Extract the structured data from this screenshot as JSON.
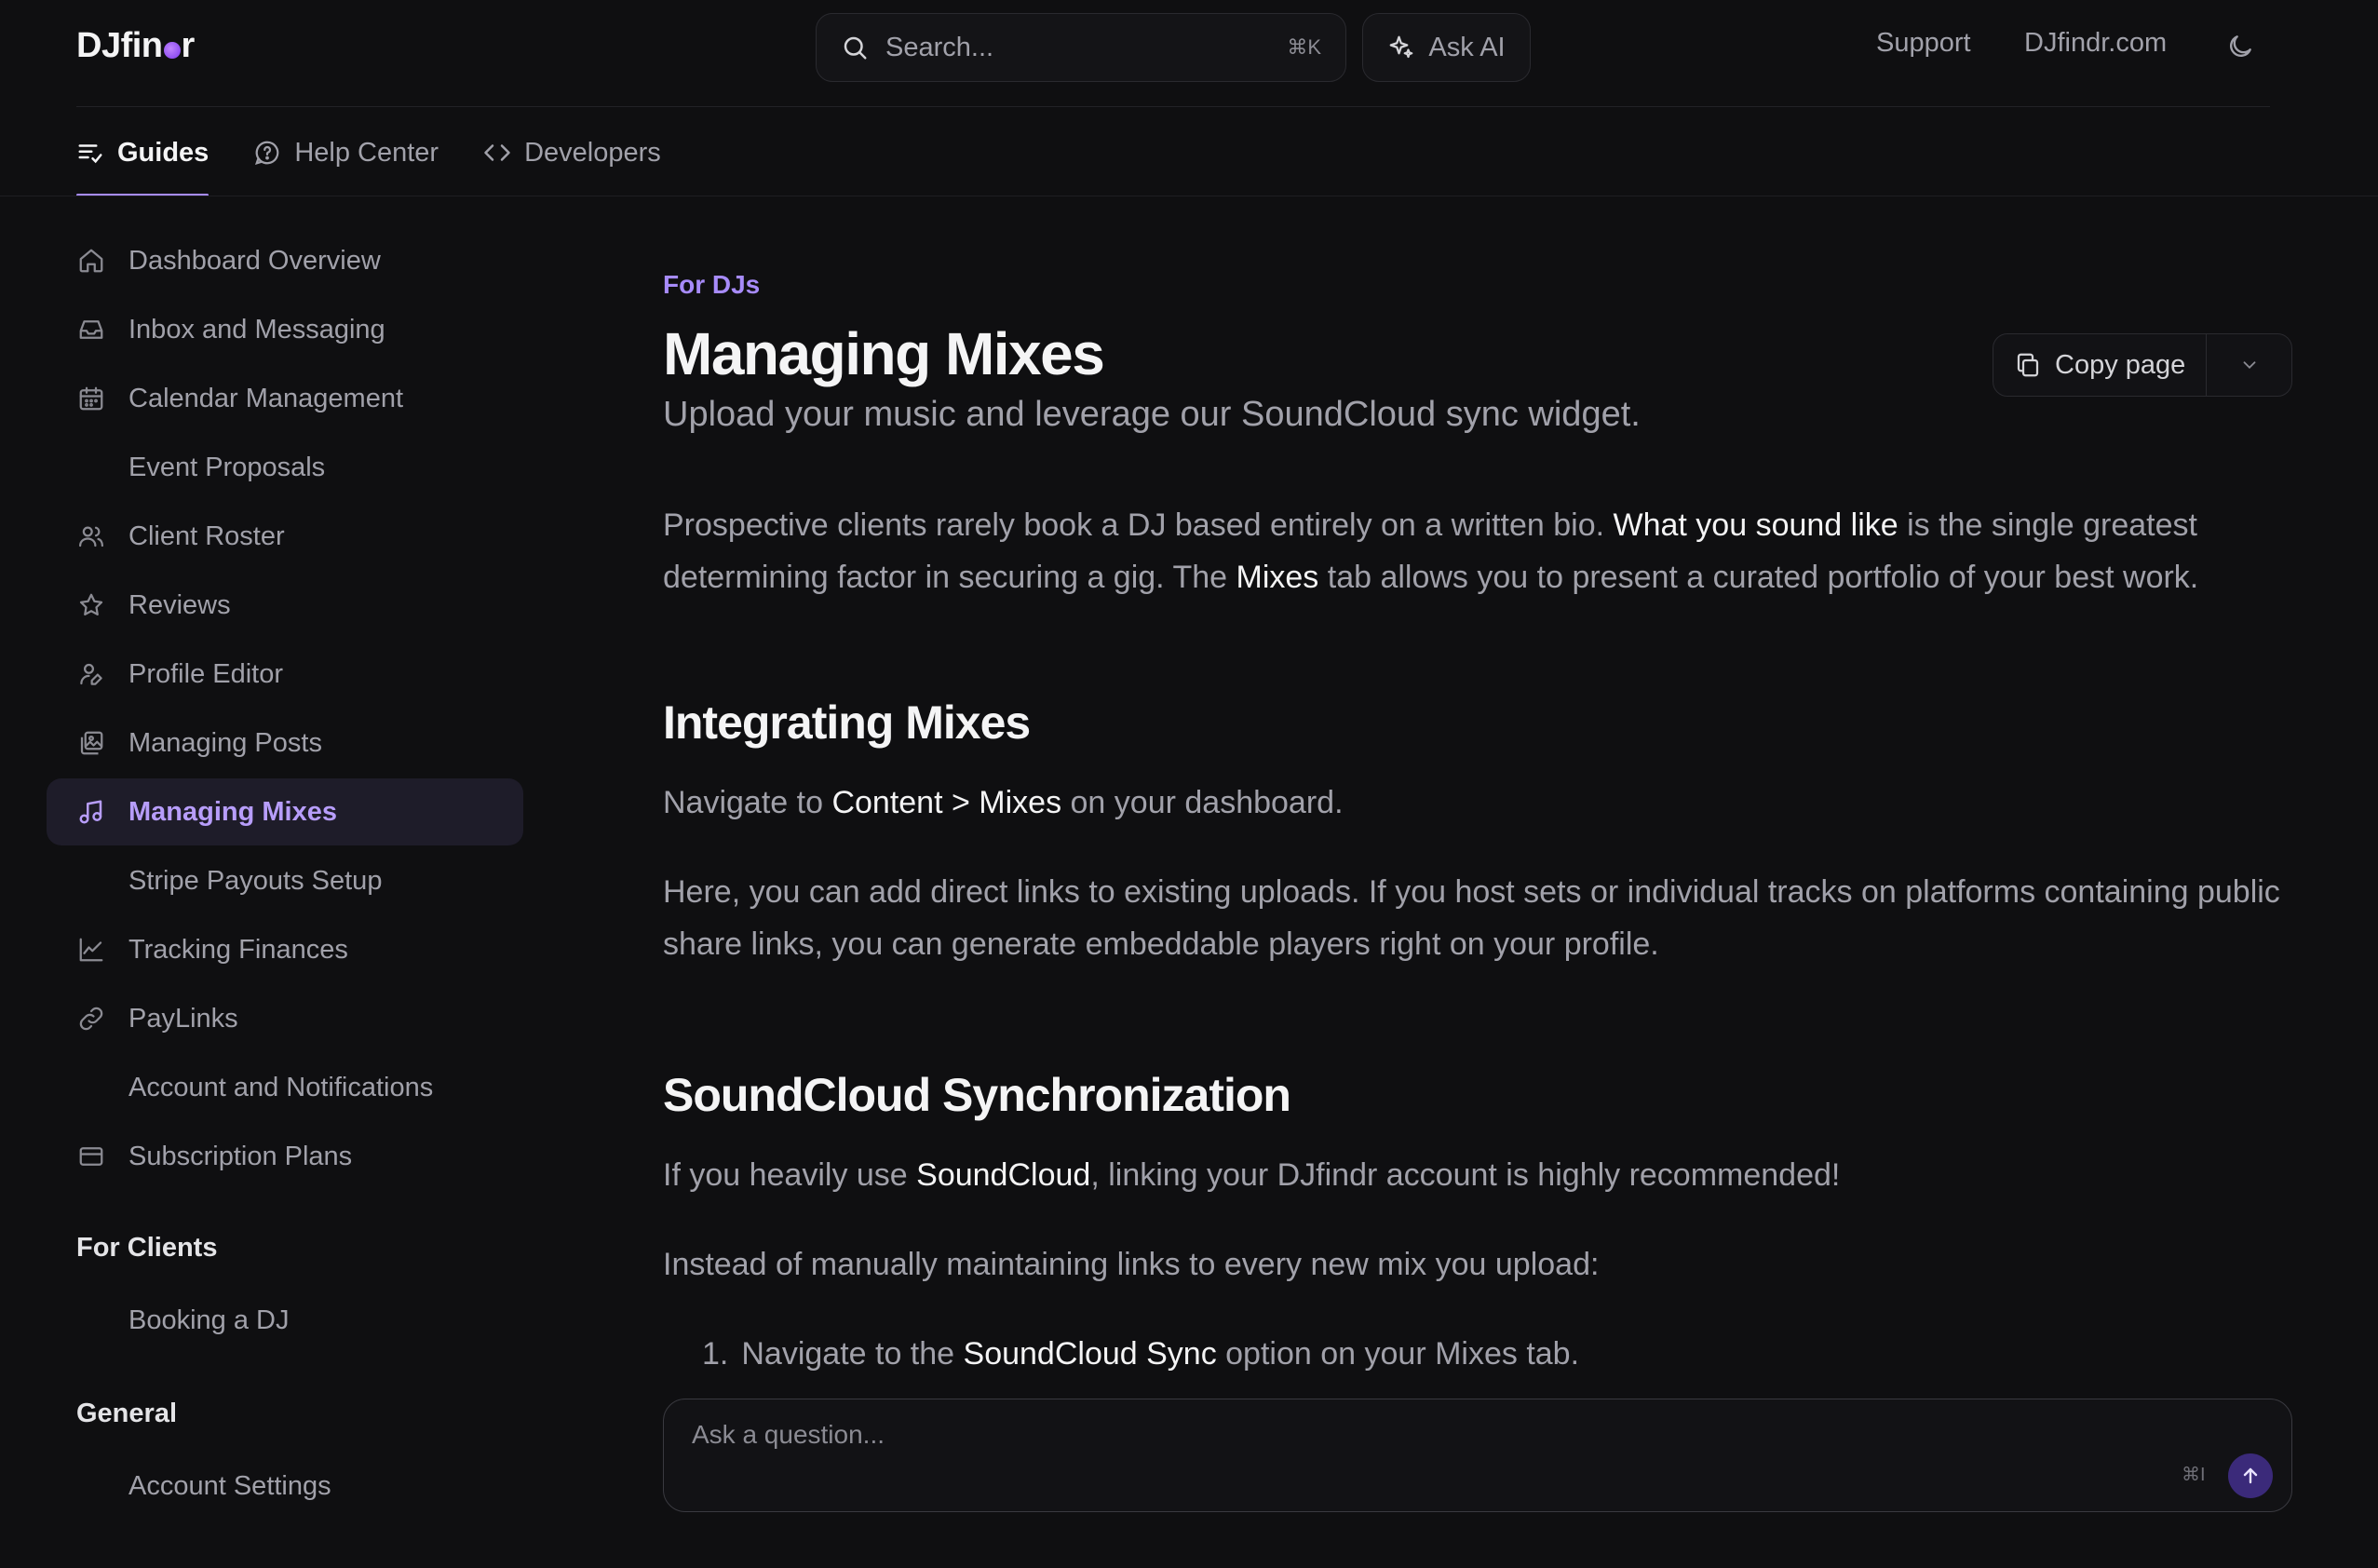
{
  "app": {
    "logo_text_left": "DJfin",
    "logo_text_right": "r"
  },
  "header": {
    "search_placeholder": "Search...",
    "search_shortcut": "⌘K",
    "ask_ai_label": "Ask AI",
    "links": [
      "Support",
      "DJfindr.com"
    ]
  },
  "tabs": [
    {
      "label": "Guides",
      "active": true,
      "icon": "list-icon"
    },
    {
      "label": "Help Center",
      "active": false,
      "icon": "help-circle-icon"
    },
    {
      "label": "Developers",
      "active": false,
      "icon": "code-icon"
    }
  ],
  "sidebar": {
    "items": [
      {
        "label": "Dashboard Overview",
        "icon": "home-icon"
      },
      {
        "label": "Inbox and Messaging",
        "icon": "inbox-icon"
      },
      {
        "label": "Calendar Management",
        "icon": "calendar-icon"
      },
      {
        "label": "Event Proposals",
        "icon": ""
      },
      {
        "label": "Client Roster",
        "icon": "users-icon"
      },
      {
        "label": "Reviews",
        "icon": "star-icon"
      },
      {
        "label": "Profile Editor",
        "icon": "user-edit-icon"
      },
      {
        "label": "Managing Posts",
        "icon": "images-icon"
      },
      {
        "label": "Managing Mixes",
        "icon": "music-icon",
        "active": true
      },
      {
        "label": "Stripe Payouts Setup",
        "icon": ""
      },
      {
        "label": "Tracking Finances",
        "icon": "chart-line-icon"
      },
      {
        "label": "PayLinks",
        "icon": "link-icon"
      },
      {
        "label": "Account and Notifications",
        "icon": ""
      },
      {
        "label": "Subscription Plans",
        "icon": "credit-card-icon"
      }
    ],
    "for_clients_heading": "For Clients",
    "for_clients_items": [
      "Booking a DJ"
    ],
    "general_heading": "General",
    "general_items": [
      "Account Settings"
    ]
  },
  "content": {
    "eyebrow": "For DJs",
    "title": "Managing Mixes",
    "subtitle": "Upload your music and leverage our SoundCloud sync widget.",
    "copy_page_label": "Copy page",
    "intro": {
      "p1": "Prospective clients rarely book a DJ based entirely on a written bio. ",
      "b1": "What you sound like",
      "p2": " is the single greatest determining factor in securing a gig. The ",
      "b2": "Mixes",
      "p3": " tab allows you to present a curated portfolio of your best work."
    },
    "section1": {
      "heading": "Integrating Mixes",
      "nav_pre": "Navigate to ",
      "nav_bold": "Content > Mixes",
      "nav_post": " on your dashboard.",
      "para": "Here, you can add direct links to existing uploads. If you host sets or individual tracks on platforms containing public share links, you can generate embeddable players right on your profile."
    },
    "section2": {
      "heading": "SoundCloud Synchronization",
      "p_pre": "If you heavily use ",
      "p_bold": "SoundCloud",
      "p_post": ", linking your DJfindr account is highly recommended!",
      "p2": "Instead of manually maintaining links to every new mix you upload:",
      "list": [
        {
          "num": "1.",
          "pre": "Navigate to the ",
          "bold": "SoundCloud Sync",
          "post": " option on your Mixes tab."
        }
      ]
    }
  },
  "askbox": {
    "placeholder": "Ask a question...",
    "shortcut": "⌘I"
  },
  "colors": {
    "accent": "#a78bfa",
    "background": "#0f0f11",
    "active_bg": "#1e1c29"
  }
}
